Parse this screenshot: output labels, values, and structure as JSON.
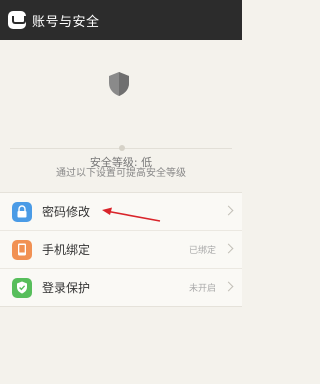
{
  "header": {
    "title": "账号与安全",
    "app_icon": "chat-app-icon"
  },
  "security": {
    "shield_icon": "shield-icon",
    "level_text": "安全等级: 低",
    "hint": "通过以下设置可提高安全等级"
  },
  "settings": {
    "items": [
      {
        "label": "密码修改",
        "icon": "lock-icon",
        "color": "#4a9be6",
        "status": ""
      },
      {
        "label": "手机绑定",
        "icon": "phone-icon",
        "color": "#f19153",
        "status": "已绑定"
      },
      {
        "label": "登录保护",
        "icon": "shield-check-icon",
        "color": "#57be5b",
        "status": "未开启"
      }
    ]
  },
  "annotation": {
    "arrow_color": "#d9242a"
  }
}
